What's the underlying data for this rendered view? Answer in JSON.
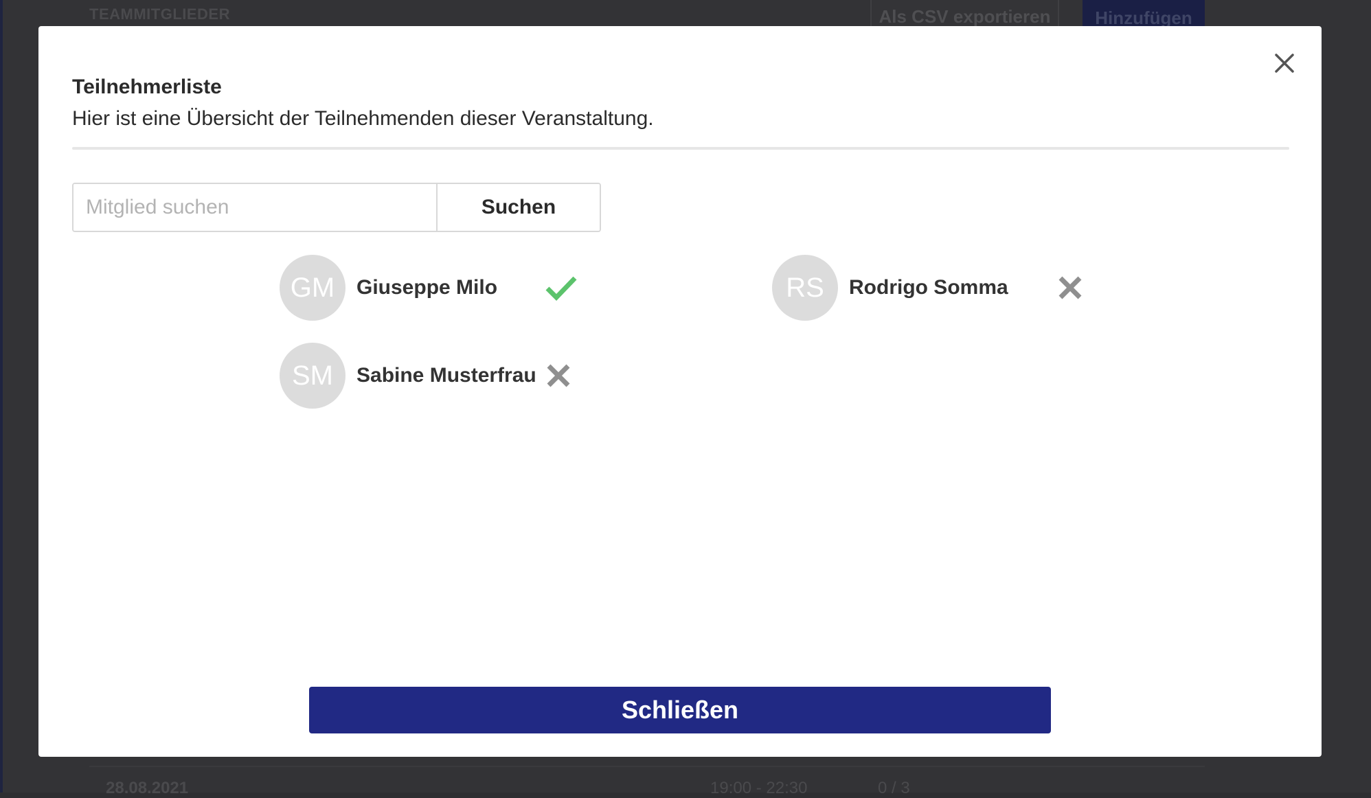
{
  "background": {
    "section_label": "TEAMMITGLIEDER",
    "export_button": "Als CSV exportieren",
    "add_button": "Hinzufügen",
    "row": {
      "date": "28.08.2021",
      "time": "19:00 - 22:30",
      "count": "0 / 3"
    }
  },
  "modal": {
    "title": "Teilnehmerliste",
    "subtitle": "Hier ist eine Übersicht der Teilnehmenden dieser Veranstaltung.",
    "close_icon": "close-icon",
    "search": {
      "placeholder": "Mitglied suchen",
      "value": "",
      "button_label": "Suchen"
    },
    "members": [
      {
        "initials": "GM",
        "name": "Giuseppe Milo",
        "status": "accepted",
        "status_icon": "check-icon",
        "status_color": "#5cc36c"
      },
      {
        "initials": "RS",
        "name": "Rodrigo Somma",
        "status": "declined",
        "status_icon": "cross-icon",
        "status_color": "#8f8f8f"
      },
      {
        "initials": "SM",
        "name": "Sabine Musterfrau",
        "status": "declined",
        "status_icon": "cross-icon",
        "status_color": "#8f8f8f"
      }
    ],
    "close_button_label": "Schließen",
    "colors": {
      "primary": "#212984",
      "accepted": "#5cc36c",
      "declined": "#8f8f8f",
      "avatar_bg": "#dcdcdc"
    }
  }
}
